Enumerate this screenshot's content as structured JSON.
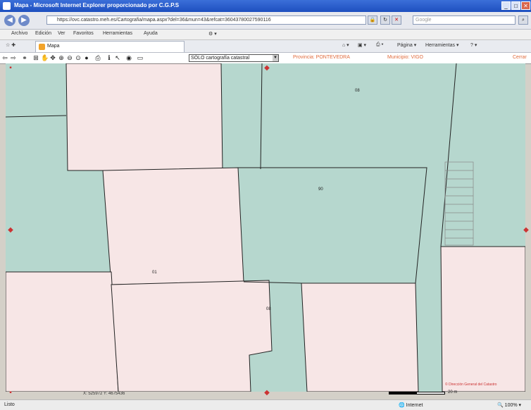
{
  "window": {
    "title": "Mapa - Microsoft Internet Explorer proporcionado por C.G.P.S",
    "minimize": "_",
    "maximize": "□",
    "close": "✕"
  },
  "addressbar": {
    "back": "◀",
    "forward": "▶",
    "url": "https://ovc.catastro.meh.es/Cartografia/mapa.aspx?del=36&mun=43&refcat=36043780027590116",
    "search_placeholder": "Google"
  },
  "menu": [
    "Archivo",
    "Edición",
    "Ver",
    "Favoritos",
    "Herramientas",
    "Ayuda"
  ],
  "tab": {
    "label": "Mapa"
  },
  "commands": {
    "page": "Página",
    "tools": "Herramientas"
  },
  "toolbar": {
    "layer": "SÓLO cartografía catastral",
    "province": "Provincia: PONTEVEDRA",
    "municipality": "Municipio: VIGO",
    "right_label": "Cerrar"
  },
  "map": {
    "parcel_labels": [
      "08",
      "90",
      "01",
      "08"
    ],
    "coordinates": "X: 525972  Y: 4675436",
    "copyright": "© Dirección General del Catastro",
    "scale_label": "20 m"
  },
  "statusbar": {
    "text": "Listo",
    "zone": "Internet",
    "zoom": "100%"
  }
}
